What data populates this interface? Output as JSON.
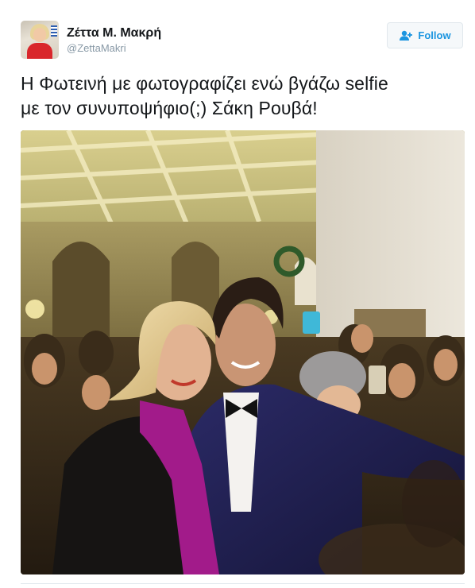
{
  "tweet": {
    "display_name": "Ζέττα Μ. Μακρή",
    "screen_name": "@ZettaMakri",
    "text_line1": "Η Φωτεινή με φωτογραφίζει ενώ βγάζω selfie",
    "text_line2": "με τον συνυποψήφιο(;) Σάκη Ρουβά!",
    "follow_label": "Follow"
  },
  "icons": {
    "follow": "add-user-icon",
    "avatar": "profile-photo"
  },
  "colors": {
    "accent": "#1b95e0",
    "text": "#14171a",
    "muted": "#8899a6",
    "border": "#e1e8ed"
  }
}
